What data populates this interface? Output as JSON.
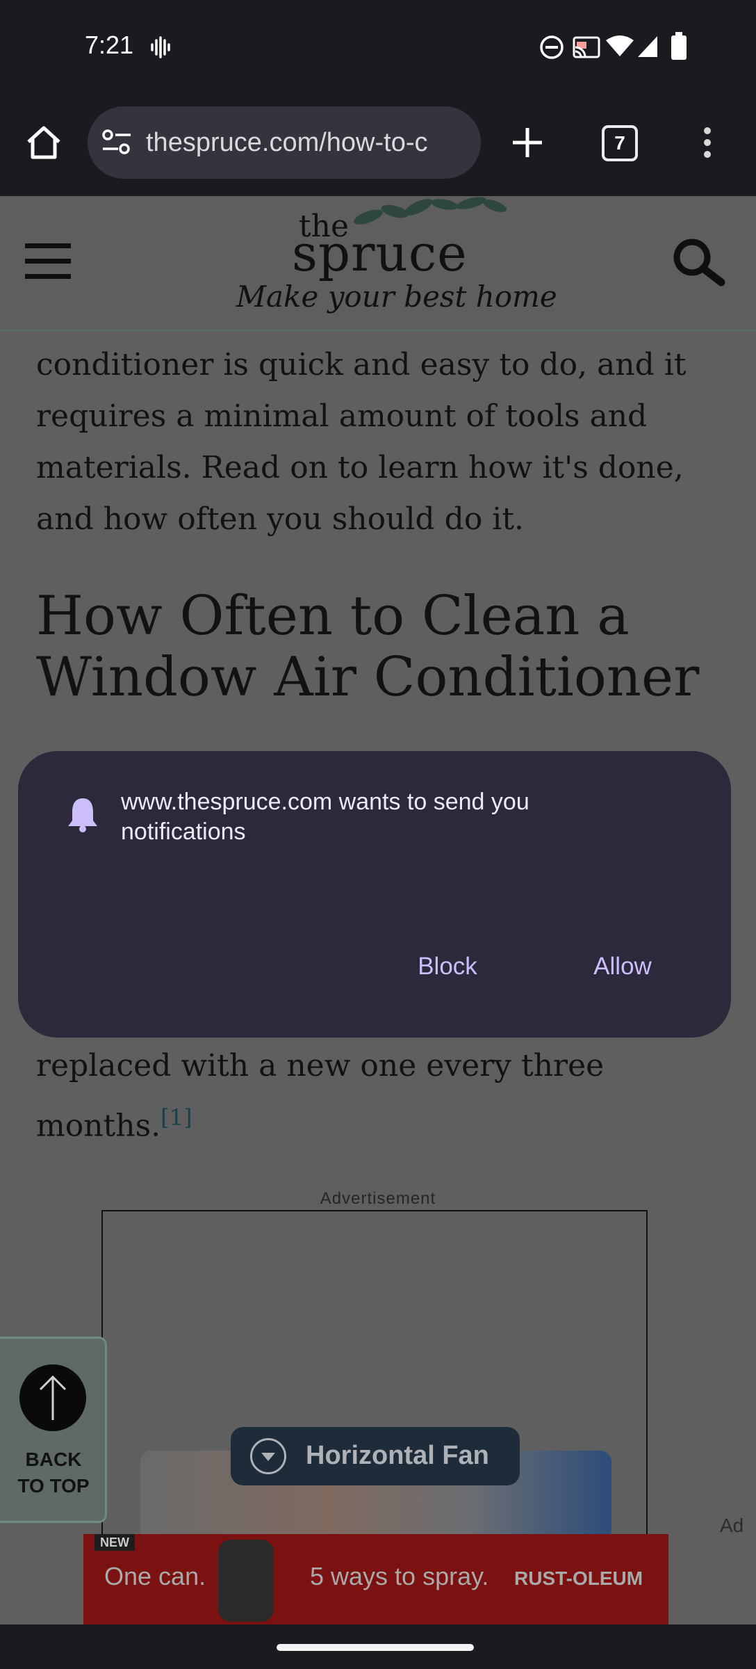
{
  "status_bar": {
    "time": "7:21",
    "icons": [
      "voice-activity-icon",
      "do-not-disturb-icon",
      "cast-icon",
      "wifi-icon",
      "cellular-signal-icon",
      "battery-icon"
    ]
  },
  "browser": {
    "url": "thespruce.com/how-to-c",
    "tab_count": "7",
    "icons": [
      "home-icon",
      "site-settings-icon",
      "new-tab-icon",
      "tab-switcher-icon",
      "more-menu-icon"
    ]
  },
  "site": {
    "logo_the": "the",
    "logo_spruce": "spruce",
    "tagline": "Make your best home"
  },
  "article": {
    "paragraph_top": "conditioner is quick and easy to do, and it requires a minimal amount of tools and materials. Read on to learn how it's done, and how often you should do it.",
    "heading": "How Often to Clean a Window Air Conditioner",
    "paragraph_bottom": "replaced with a new one every three months.",
    "footnote": "[1]"
  },
  "advertisement": {
    "label": "Advertisement",
    "video_title": "Horizontal Fan",
    "ad_mark": "Ad"
  },
  "back_to_top": {
    "line1": "BACK",
    "line2": "TO TOP"
  },
  "banner_ad": {
    "badge": "NEW",
    "text_left": "One can.",
    "text_right": "5 ways to spray.",
    "brand": "RUST-OLEUM"
  },
  "notification_dialog": {
    "message": "www.thespruce.com wants to send you notifications",
    "block_label": "Block",
    "allow_label": "Allow"
  },
  "colors": {
    "dialog_bg": "#2c2a3a",
    "dialog_accent": "#cdbdfb",
    "bar_bg": "#1a1a20"
  }
}
